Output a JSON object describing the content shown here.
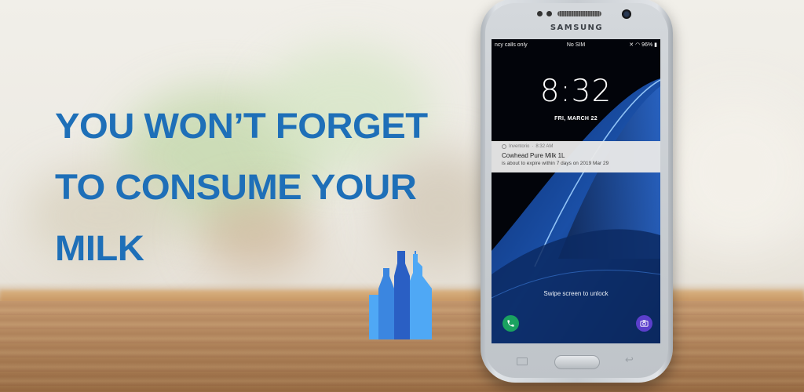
{
  "headline": {
    "line1": "YOU WON’T FORGET",
    "line2": "TO CONSUME YOUR",
    "line3": "MILK"
  },
  "phone": {
    "brand": "SAMSUNG",
    "status_bar": {
      "left": "ncy calls only",
      "center": "No SIM",
      "battery": "96%"
    },
    "lock_screen": {
      "time": "8:32",
      "date": "FRI, MARCH 22",
      "swipe_hint": "Swipe screen to unlock"
    },
    "notification": {
      "app": "Inventorio",
      "time": "8:32 AM",
      "title": "Cowhead Pure Milk 1L",
      "body": "is about to expire within 7 days on 2019 Mar 29"
    }
  },
  "colors": {
    "headline": "#1e6fb8",
    "logo_light": "#4fa8f5",
    "logo_mid": "#3b86e0",
    "logo_dark": "#2a5fc4",
    "notification_bg": "#e8e8e8"
  },
  "icons": [
    "phone-dial-icon",
    "camera-icon",
    "notification-app-icon",
    "wifi-icon",
    "battery-icon",
    "mute-icon"
  ]
}
